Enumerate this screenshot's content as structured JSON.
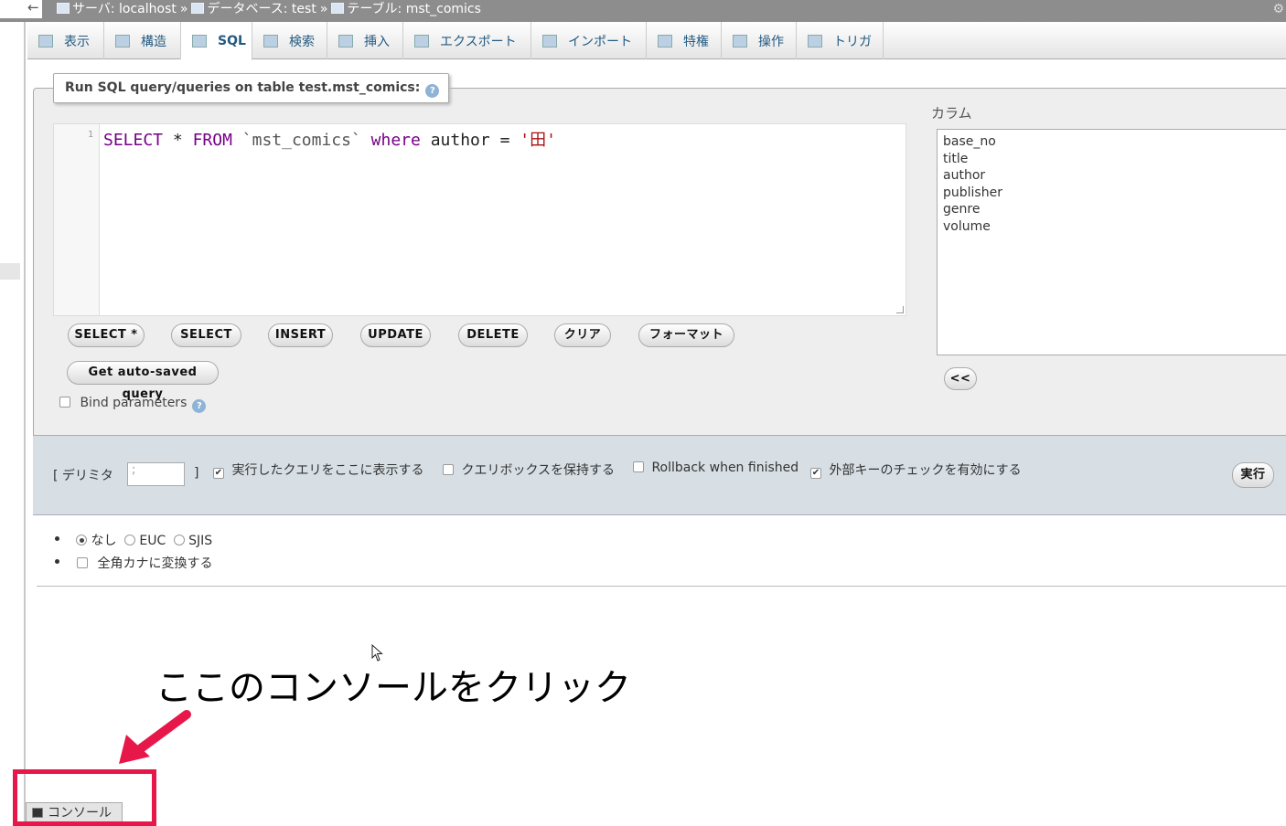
{
  "breadcrumb": {
    "back_glyph": "←",
    "server": "サーバ: localhost",
    "database": "データベース: test",
    "table": "テーブル: mst_comics",
    "separator": "»"
  },
  "tabs": [
    {
      "label": "表示",
      "icon": "table-browse-icon",
      "active": false
    },
    {
      "label": "構造",
      "icon": "structure-icon",
      "active": false
    },
    {
      "label": "SQL",
      "icon": "sql-icon",
      "active": true
    },
    {
      "label": "検索",
      "icon": "search-icon",
      "active": false
    },
    {
      "label": "挿入",
      "icon": "insert-icon",
      "active": false
    },
    {
      "label": "エクスポート",
      "icon": "export-icon",
      "active": false
    },
    {
      "label": "インポート",
      "icon": "import-icon",
      "active": false
    },
    {
      "label": "特権",
      "icon": "privileges-icon",
      "active": false
    },
    {
      "label": "操作",
      "icon": "wrench-icon",
      "active": false
    },
    {
      "label": "トリガ",
      "icon": "trigger-icon",
      "active": false
    }
  ],
  "query_panel": {
    "legend": "Run SQL query/queries on table test.mst_comics:",
    "editor": {
      "line_number": "1",
      "tokens": {
        "select": "SELECT",
        "star": "*",
        "from": "FROM",
        "table": "`mst_comics`",
        "where": "where",
        "column": "author",
        "op": "=",
        "value": "'田'"
      }
    },
    "buttons": {
      "select_star": "SELECT *",
      "select": "SELECT",
      "insert": "INSERT",
      "update": "UPDATE",
      "delete": "DELETE",
      "clear": "クリア",
      "format": "フォーマット",
      "auto_saved": "Get auto-saved query"
    },
    "bind_parameters": "Bind parameters"
  },
  "columns": {
    "label": "カラム",
    "items": [
      "base_no",
      "title",
      "author",
      "publisher",
      "genre",
      "volume"
    ],
    "insert_button": "<<"
  },
  "options": {
    "delimiter_label": "[ デリミタ",
    "delimiter_close": "]",
    "delimiter_value": ";",
    "show_query": {
      "label": "実行したクエリをここに表示する",
      "checked": true
    },
    "keep_box": {
      "label": "クエリボックスを保持する",
      "checked": false
    },
    "rollback": {
      "label": "Rollback when finished",
      "checked": false
    },
    "fk_check": {
      "label": "外部キーのチェックを有効にする",
      "checked": true
    },
    "execute": "実行"
  },
  "encoding": {
    "options": [
      {
        "label": "なし",
        "selected": true
      },
      {
        "label": "EUC",
        "selected": false
      },
      {
        "label": "SJIS",
        "selected": false
      }
    ],
    "kana": {
      "label": "全角カナに変換する",
      "checked": false
    }
  },
  "annotation": {
    "text": "ここのコンソールをクリック",
    "color": "#e8174a"
  },
  "console_tab": "コンソール"
}
